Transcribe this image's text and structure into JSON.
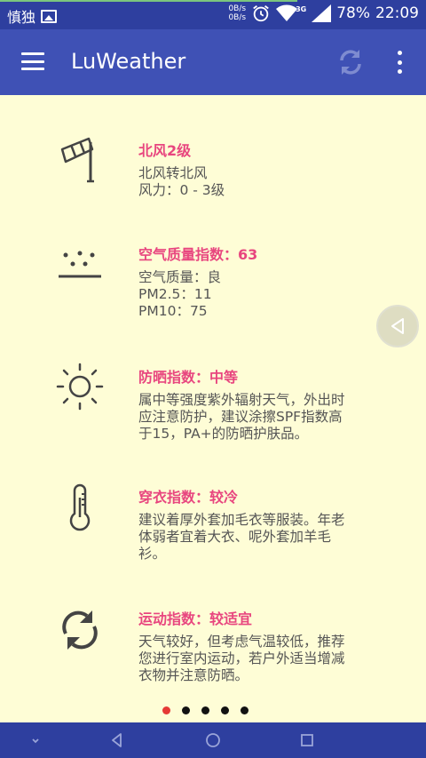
{
  "status_bar": {
    "carrier": "慎独",
    "net_up": "0B/s",
    "net_down": "0B/s",
    "network": "3G",
    "battery": "78%",
    "time": "22:09"
  },
  "app_bar": {
    "title": "LuWeather"
  },
  "cards": [
    {
      "icon": "windsock-icon",
      "title": "北风2级",
      "lines": [
        "北风转北风",
        "风力：0 - 3级"
      ]
    },
    {
      "icon": "air-quality-icon",
      "title": "空气质量指数：63",
      "lines": [
        "空气质量：良",
        "PM2.5：11",
        "PM10：75"
      ]
    },
    {
      "icon": "sun-icon",
      "title": "防晒指数：中等",
      "lines": [
        "属中等强度紫外辐射天气，外出时",
        "应注意防护，建议涂擦SPF指数高",
        "于15，PA+的防晒护肤品。"
      ]
    },
    {
      "icon": "thermometer-icon",
      "title": "穿衣指数：较冷",
      "lines": [
        "建议着厚外套加毛衣等服装。年老",
        "体弱者宜着大衣、呢外套加羊毛",
        "衫。"
      ]
    },
    {
      "icon": "sync-icon",
      "title": "运动指数：较适宜",
      "lines": [
        "天气较好，但考虑气温较低，推荐",
        "您进行室内运动，若户外适当增减",
        "衣物并注意防晒。"
      ]
    }
  ],
  "pager": {
    "count": 5,
    "active": 0
  },
  "colors": {
    "status_bar": "#2E3F9F",
    "app_bar": "#3F51B5",
    "background": "#FEFDD6",
    "title_accent": "#E8467F"
  }
}
